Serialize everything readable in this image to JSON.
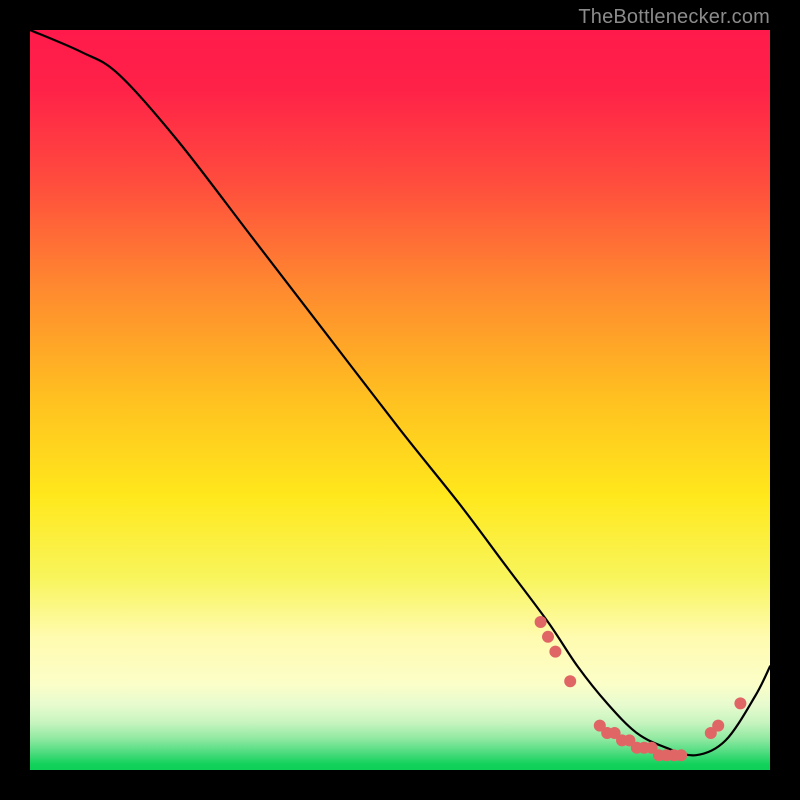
{
  "attribution": "TheBottlenecker.com",
  "colors": {
    "top": "#ff1a4b",
    "mid_warm": "#ffe81c",
    "lower_warm": "#fffbaf",
    "pale_green": "#d4f7c0",
    "green": "#14d45d",
    "black": "#000000",
    "curve": "#000000",
    "markers": "#e06666"
  },
  "chart_data": {
    "type": "line",
    "title": "",
    "xlabel": "",
    "ylabel": "",
    "xlim": [
      0,
      100
    ],
    "ylim": [
      0,
      100
    ],
    "series": [
      {
        "name": "curve",
        "x": [
          0,
          7,
          12,
          20,
          30,
          40,
          50,
          58,
          64,
          70,
          74,
          78,
          82,
          86,
          90,
          94,
          98,
          100
        ],
        "y": [
          100,
          97,
          94,
          85,
          72,
          59,
          46,
          36,
          28,
          20,
          14,
          9,
          5,
          3,
          2,
          4,
          10,
          14
        ]
      },
      {
        "name": "markers",
        "x": [
          69,
          70,
          71,
          73,
          77,
          78,
          79,
          80,
          81,
          82,
          83,
          84,
          85,
          86,
          87,
          88,
          92,
          93,
          96
        ],
        "y": [
          20,
          18,
          16,
          12,
          6,
          5,
          5,
          4,
          4,
          3,
          3,
          3,
          2,
          2,
          2,
          2,
          5,
          6,
          9
        ]
      }
    ],
    "gradient_bands": [
      {
        "offset": 0.0,
        "color": "#ff1a4b"
      },
      {
        "offset": 0.08,
        "color": "#ff2248"
      },
      {
        "offset": 0.2,
        "color": "#ff4a3e"
      },
      {
        "offset": 0.35,
        "color": "#ff8a2f"
      },
      {
        "offset": 0.5,
        "color": "#ffc120"
      },
      {
        "offset": 0.63,
        "color": "#ffe81c"
      },
      {
        "offset": 0.74,
        "color": "#f8f55c"
      },
      {
        "offset": 0.82,
        "color": "#fffbaf"
      },
      {
        "offset": 0.885,
        "color": "#fbfec8"
      },
      {
        "offset": 0.912,
        "color": "#e7fbcf"
      },
      {
        "offset": 0.936,
        "color": "#c7f4bf"
      },
      {
        "offset": 0.958,
        "color": "#8fe9a0"
      },
      {
        "offset": 0.976,
        "color": "#4fdc80"
      },
      {
        "offset": 0.992,
        "color": "#12d25b"
      },
      {
        "offset": 1.0,
        "color": "#0ecf58"
      }
    ]
  }
}
